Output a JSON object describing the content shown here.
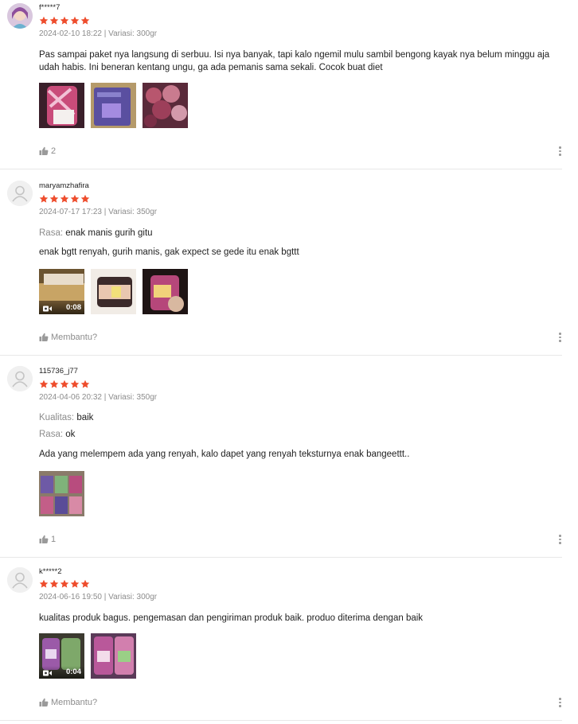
{
  "reviews": [
    {
      "username": "f*****7",
      "rating": 5,
      "date": "2024-02-10 18:22",
      "separator": "|",
      "variant": "Variasi: 300gr",
      "attributes": [],
      "comment": "Pas sampai paket nya langsung di serbuu. Isi nya banyak, tapi kalo ngemil mulu sambil bengong kayak nya belum minggu aja udah habis. Ini beneran kentang ungu, ga ada pemanis sama sekali. Cocok buat diet",
      "media": [
        {
          "kind": "image"
        },
        {
          "kind": "image"
        },
        {
          "kind": "image"
        }
      ],
      "likes_text": "2"
    },
    {
      "username": "maryamzhafira",
      "rating": 5,
      "date": "2024-07-17 17:23",
      "separator": "|",
      "variant": "Variasi: 350gr",
      "attributes": [
        {
          "label": "Rasa:",
          "value": "enak manis gurih gitu"
        }
      ],
      "comment": "enak bgtt renyah, gurih manis, gak expect se gede itu enak bgttt",
      "media": [
        {
          "kind": "video",
          "duration": "0:08"
        },
        {
          "kind": "image"
        },
        {
          "kind": "image"
        }
      ],
      "likes_text": "Membantu?"
    },
    {
      "username": "115736_j77",
      "rating": 5,
      "date": "2024-04-06 20:32",
      "separator": "|",
      "variant": "Variasi: 350gr",
      "attributes": [
        {
          "label": "Kualitas:",
          "value": "baik"
        },
        {
          "label": "Rasa:",
          "value": "ok"
        }
      ],
      "comment": "Ada yang melempem ada yang renyah, kalo dapet yang renyah teksturnya enak bangeettt..",
      "media": [
        {
          "kind": "image"
        }
      ],
      "likes_text": "1"
    },
    {
      "username": "k*****2",
      "rating": 5,
      "date": "2024-06-16 19:50",
      "separator": "|",
      "variant": "Variasi: 300gr",
      "attributes": [],
      "comment": "kualitas produk bagus. pengemasan dan pengiriman produk baik. produo diterima dengan baik",
      "media": [
        {
          "kind": "video",
          "duration": "0:04"
        },
        {
          "kind": "image"
        }
      ],
      "likes_text": "Membantu?"
    }
  ],
  "colors": {
    "star": "#ee4d2d",
    "muted": "#8c8c8c",
    "divider": "#e8e8e8"
  },
  "icons": {
    "rating": "star-icon",
    "helpful": "thumbs-up-icon",
    "menu": "more-vertical-icon",
    "video": "video-camera-icon",
    "default_avatar": "user-silhouette-icon"
  }
}
